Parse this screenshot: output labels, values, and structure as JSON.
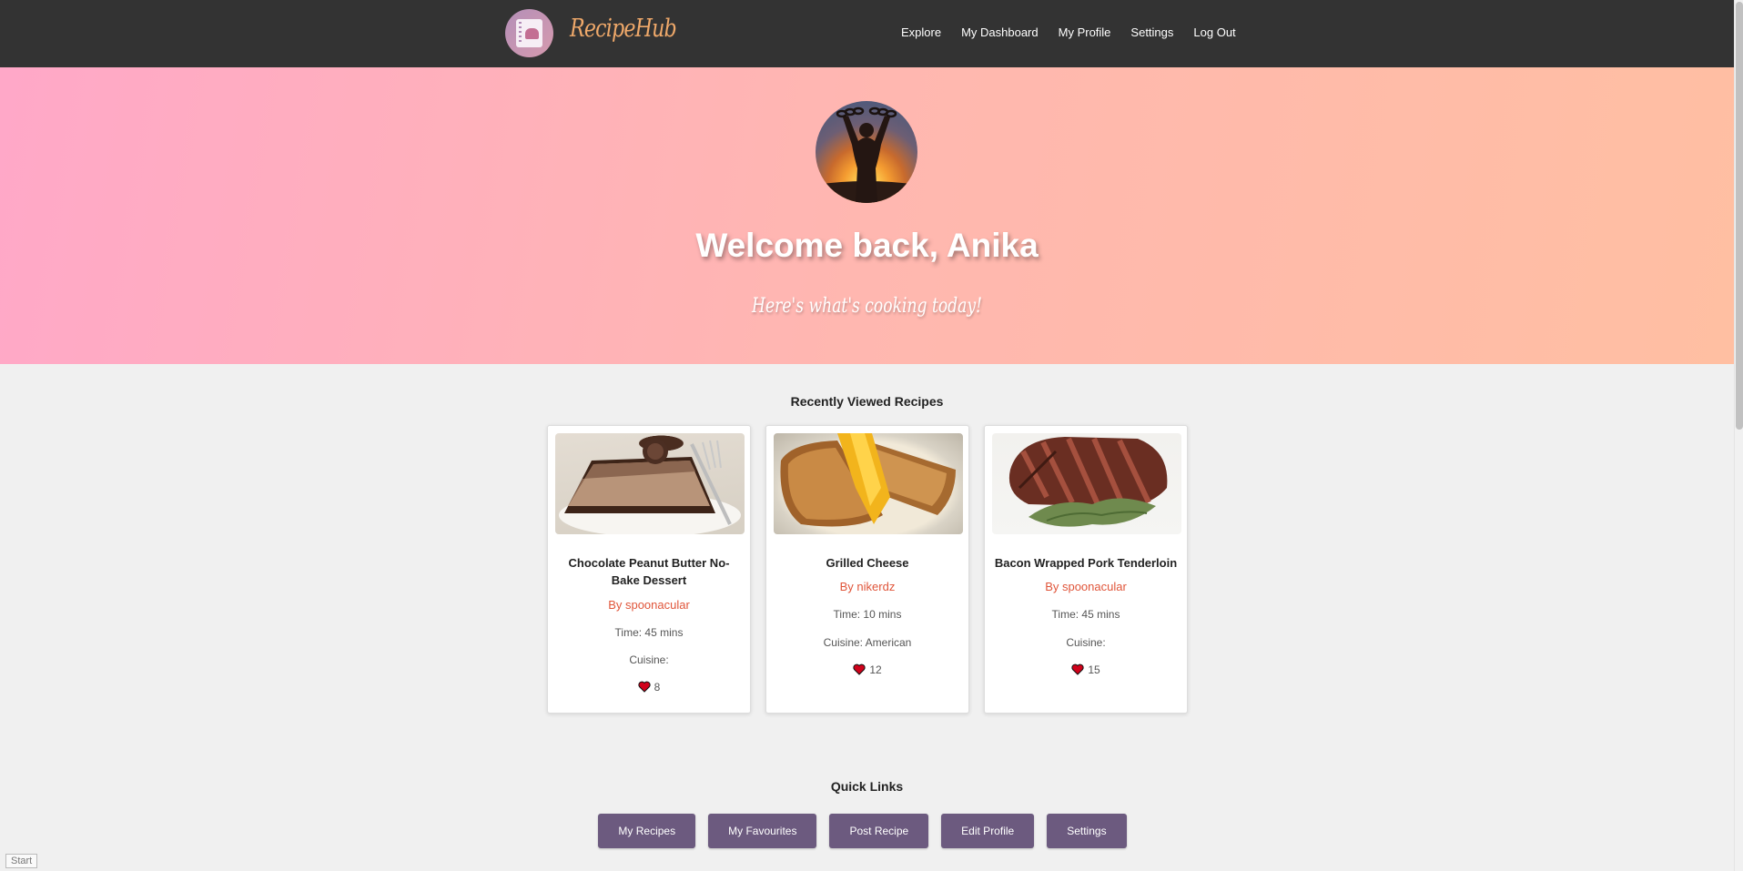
{
  "nav": {
    "brand": "RecipeHub",
    "links": [
      "Explore",
      "My Dashboard",
      "My Profile",
      "Settings",
      "Log Out"
    ]
  },
  "hero": {
    "welcome": "Welcome back, Anika",
    "tagline": "Here's what's cooking today!"
  },
  "recently_viewed": {
    "title": "Recently Viewed Recipes",
    "cards": [
      {
        "title": "Chocolate Peanut Butter No-Bake Dessert",
        "author": "By spoonacular",
        "time": "Time: 45 mins",
        "cuisine": "Cuisine:",
        "likes": "8"
      },
      {
        "title": "Grilled Cheese",
        "author": "By nikerdz",
        "time": "Time: 10 mins",
        "cuisine": "Cuisine: American",
        "likes": "12"
      },
      {
        "title": "Bacon Wrapped Pork Tenderloin",
        "author": "By spoonacular",
        "time": "Time: 45 mins",
        "cuisine": "Cuisine:",
        "likes": "15"
      }
    ]
  },
  "quick_links": {
    "title": "Quick Links",
    "buttons": [
      "My Recipes",
      "My Favourites",
      "Post Recipe",
      "Edit Profile",
      "Settings"
    ]
  },
  "status": {
    "start": "Start"
  },
  "colors": {
    "nav_bg": "#333333",
    "brand": "#f0a96a",
    "author": "#e0553a",
    "button": "#6c5a7f",
    "heart": "#d0021b"
  }
}
